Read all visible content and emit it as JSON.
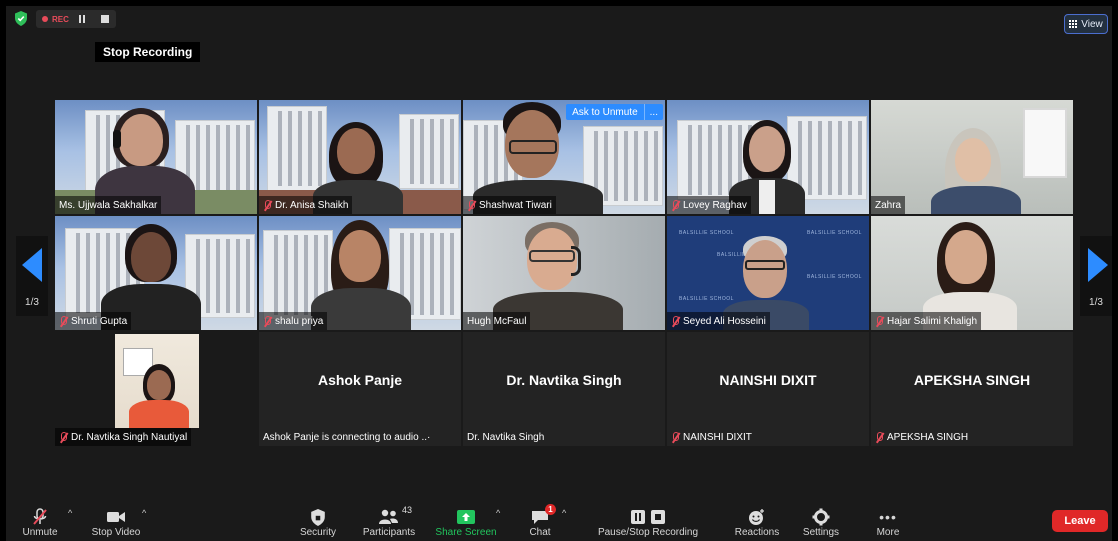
{
  "recording": {
    "label": "REC",
    "tooltip": "Stop Recording"
  },
  "view_button": {
    "label": "View"
  },
  "pagination": {
    "left": "1/3",
    "right": "1/3"
  },
  "tiles": [
    {
      "name": "Ms. Ujjwala Sakhalkar",
      "muted": false,
      "active": true
    },
    {
      "name": "Dr. Anisa Shaikh",
      "muted": true
    },
    {
      "name": "Shashwat Tiwari",
      "muted": true,
      "ask_to_unmute": "Ask to Unmute",
      "more": "..."
    },
    {
      "name": "Lovey Raghav",
      "muted": true
    },
    {
      "name": "Zahra",
      "muted": false
    },
    {
      "name": "Shruti Gupta",
      "muted": true
    },
    {
      "name": "shalu priya",
      "muted": true
    },
    {
      "name": "Hugh McFaul",
      "muted": false
    },
    {
      "name": "Seyed Ali Hosseini",
      "muted": true,
      "bg_text": "BALSILLIE SCHOOL"
    },
    {
      "name": "Hajar Salimi Khaligh",
      "muted": true
    },
    {
      "name": "Dr. Navtika Singh Nautiyal",
      "muted": true
    },
    {
      "name": "Ashok Panje is connecting to audio ..·",
      "card": "Ashok Panje"
    },
    {
      "name": "Dr. Navtika Singh",
      "card": "Dr. Navtika Singh"
    },
    {
      "name": "NAINSHI DIXIT",
      "card": "NAINSHI DIXIT",
      "muted": true
    },
    {
      "name": "APEKSHA SINGH",
      "card": "APEKSHA SINGH",
      "muted": true
    }
  ],
  "toolbar": {
    "unmute": "Unmute",
    "stop_video": "Stop Video",
    "security": "Security",
    "participants": "Participants",
    "participants_count": "43",
    "share_screen": "Share Screen",
    "chat": "Chat",
    "chat_badge": "1",
    "pause_stop_recording": "Pause/Stop Recording",
    "reactions": "Reactions",
    "settings": "Settings",
    "more": "More",
    "leave": "Leave"
  },
  "colors": {
    "accent": "#2d8cff",
    "share": "#22c55e",
    "leave": "#e02828",
    "active_border": "#bfe06a"
  }
}
